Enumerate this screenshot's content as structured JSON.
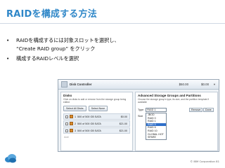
{
  "slide": {
    "title": "RAIDを構成する方法",
    "bullets": [
      "RAIDを構成するには対象スロットを選択し、\n“Create RAID group” をクリック",
      "構成するRAIDレベルを選択"
    ],
    "bullet_mark": "•"
  },
  "screenshot": {
    "header": {
      "title": "Disk Controller",
      "price1": "$50.00",
      "price2": "$0.00",
      "caret": "▼"
    },
    "disks_pane": {
      "title": "Disks",
      "description": "Click on disks to add or remove from the storage group being edited",
      "select_all": "Select All Disks",
      "select_none": "Select None",
      "rows": [
        {
          "num": "1",
          "label": "500 of 500 GB SATA",
          "price": "$0.00"
        },
        {
          "num": "2",
          "label": "500 of 500 GB SATA",
          "price": "$21.00"
        },
        {
          "num": "3",
          "label": "500 of 500 GB SATA",
          "price": "$21.00"
        }
      ],
      "add_label": "Add"
    },
    "groups_pane": {
      "title": "Advanced Storage Groups and Partitions",
      "description": "Choose the storage group's type, its size, and the partition template if available",
      "type_label": "Type",
      "type_value": "RAID 1",
      "size_label": "Size",
      "remove": "Remove",
      "done": "Done",
      "dropdown": [
        "JBOD",
        "RAID 0",
        "RAID 1",
        "RAID 5",
        "RAID 6",
        "RAID 10",
        "GLOBAL HOT SPARE"
      ],
      "dropdown_selected_index": 3
    }
  },
  "footer": {
    "copyright": "© IBM Corporation  81"
  },
  "colors": {
    "title_blue": "#2f87c8",
    "selection": "#2f6fc9"
  }
}
